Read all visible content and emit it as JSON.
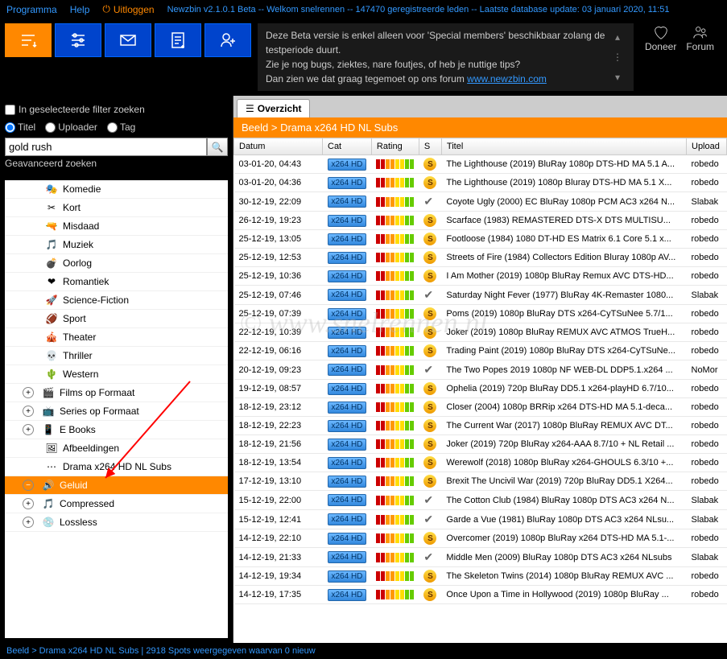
{
  "menu": {
    "programma": "Programma",
    "help": "Help",
    "uitloggen": "Uitloggen",
    "info": "Newzbin v2.1.0.1 Beta -- Welkom snelrennen -- 147470 geregistreerde leden -- Laatste database update: 03 januari 2020, 11:51"
  },
  "beta": {
    "l1": "Deze Beta versie is enkel alleen voor 'Special members' beschikbaar zolang de testperiode duurt.",
    "l2": "Zie je nog bugs, ziektes, nare foutjes, of heb je nuttige tips?",
    "l3": "Dan zien we dat graag tegemoet op ons forum ",
    "link": "www.newzbin.com"
  },
  "actions": {
    "doneer": "Doneer",
    "forum": "Forum"
  },
  "filter": {
    "chk": "In geselecteerde filter zoeken",
    "r1": "Titel",
    "r2": "Uploader",
    "r3": "Tag",
    "value": "gold rush",
    "adv": "Geavanceerd zoeken"
  },
  "tree": [
    {
      "lvl": 1,
      "icon": "🎭",
      "label": "Komedie"
    },
    {
      "lvl": 1,
      "icon": "✂",
      "label": "Kort"
    },
    {
      "lvl": 1,
      "icon": "🔫",
      "label": "Misdaad"
    },
    {
      "lvl": 1,
      "icon": "🎵",
      "label": "Muziek"
    },
    {
      "lvl": 1,
      "icon": "💣",
      "label": "Oorlog"
    },
    {
      "lvl": 1,
      "icon": "❤",
      "label": "Romantiek"
    },
    {
      "lvl": 1,
      "icon": "🚀",
      "label": "Science-Fiction"
    },
    {
      "lvl": 1,
      "icon": "🏈",
      "label": "Sport"
    },
    {
      "lvl": 1,
      "icon": "🎪",
      "label": "Theater"
    },
    {
      "lvl": 1,
      "icon": "💀",
      "label": "Thriller"
    },
    {
      "lvl": 1,
      "icon": "🌵",
      "label": "Western"
    },
    {
      "lvl": 0,
      "exp": "+",
      "icon": "🎬",
      "label": "Films op Formaat"
    },
    {
      "lvl": 0,
      "exp": "+",
      "icon": "📺",
      "label": "Series op Formaat"
    },
    {
      "lvl": 0,
      "exp": "+",
      "icon": "📱",
      "label": "E Books"
    },
    {
      "lvl": 1,
      "icon": "🖼",
      "label": "Afbeeldingen"
    },
    {
      "lvl": 1,
      "icon": "⋯",
      "label": "Drama x264 HD NL Subs"
    },
    {
      "lvl": 0,
      "exp": "−",
      "icon": "🔊",
      "label": "Geluid",
      "sel": true
    },
    {
      "lvl": 0,
      "exp": "+",
      "icon": "🎵",
      "label": "Compressed"
    },
    {
      "lvl": 0,
      "exp": "+",
      "icon": "💿",
      "label": "Lossless"
    }
  ],
  "tab": "Overzicht",
  "breadcrumb": "Beeld  >  Drama x264 HD NL Subs",
  "cols": {
    "datum": "Datum",
    "cat": "Cat",
    "rating": "Rating",
    "s": "S",
    "titel": "Titel",
    "upload": "Upload"
  },
  "badge": "x264 HD",
  "rows": [
    {
      "d": "03-01-20, 04:43",
      "s": "s",
      "t": "The Lighthouse (2019) BluRay 1080p DTS-HD MA 5.1 A...",
      "u": "robedo"
    },
    {
      "d": "03-01-20, 04:36",
      "s": "s",
      "t": "The Lighthouse (2019) 1080p Bluray DTS-HD MA 5.1 X...",
      "u": "robedo"
    },
    {
      "d": "30-12-19, 22:09",
      "s": "c",
      "t": "Coyote Ugly (2000) EC BluRay 1080p PCM AC3 x264 N...",
      "u": "Slabak"
    },
    {
      "d": "26-12-19, 19:23",
      "s": "s",
      "t": "Scarface (1983) REMASTERED DTS-X DTS MULTISU...",
      "u": "robedo"
    },
    {
      "d": "25-12-19, 13:05",
      "s": "s",
      "t": "Footloose (1984) 1080 DT-HD ES Matrix 6.1 Core 5.1 x...",
      "u": "robedo"
    },
    {
      "d": "25-12-19, 12:53",
      "s": "s",
      "t": "Streets of Fire (1984) Collectors Edition Bluray 1080p AV...",
      "u": "robedo"
    },
    {
      "d": "25-12-19, 10:36",
      "s": "s",
      "t": "I Am Mother (2019) 1080p BluRay Remux AVC DTS-HD...",
      "u": "robedo"
    },
    {
      "d": "25-12-19, 07:46",
      "s": "c",
      "t": "Saturday Night Fever (1977) BluRay 4K-Remaster 1080...",
      "u": "Slabak"
    },
    {
      "d": "25-12-19, 07:39",
      "s": "s",
      "t": "Poms (2019) 1080p BluRay DTS x264-CyTSuNee 5.7/1...",
      "u": "robedo"
    },
    {
      "d": "22-12-19, 10:39",
      "s": "s",
      "t": "Joker (2019) 1080p BluRay REMUX AVC ATMOS TrueH...",
      "u": "robedo"
    },
    {
      "d": "22-12-19, 06:16",
      "s": "s",
      "t": "Trading Paint (2019) 1080p BluRay DTS x264-CyTSuNe...",
      "u": "robedo"
    },
    {
      "d": "20-12-19, 09:23",
      "s": "c",
      "t": "The Two Popes 2019 1080p NF WEB-DL DDP5.1.x264 ...",
      "u": "NoMor"
    },
    {
      "d": "19-12-19, 08:57",
      "s": "s",
      "t": "Ophelia (2019) 720p BluRay DD5.1 x264-playHD 6.7/10...",
      "u": "robedo"
    },
    {
      "d": "18-12-19, 23:12",
      "s": "s",
      "t": "Closer (2004) 1080p BRRip x264 DTS-HD MA 5.1-deca...",
      "u": "robedo"
    },
    {
      "d": "18-12-19, 22:23",
      "s": "s",
      "t": "The Current War (2017) 1080p BluRay REMUX AVC DT...",
      "u": "robedo"
    },
    {
      "d": "18-12-19, 21:56",
      "s": "s",
      "t": "Joker (2019) 720p BluRay x264-AAA 8.7/10 + NL Retail ...",
      "u": "robedo"
    },
    {
      "d": "18-12-19, 13:54",
      "s": "s",
      "t": "Werewolf (2018) 1080p BluRay x264-GHOULS 6.3/10 +...",
      "u": "robedo"
    },
    {
      "d": "17-12-19, 13:10",
      "s": "s",
      "t": "Brexit The Uncivil War (2019) 720p BluRay DD5.1 X264...",
      "u": "robedo"
    },
    {
      "d": "15-12-19, 22:00",
      "s": "c",
      "t": "The Cotton Club (1984) BluRay 1080p DTS AC3 x264 N...",
      "u": "Slabak"
    },
    {
      "d": "15-12-19, 12:41",
      "s": "c",
      "t": "Garde a Vue (1981) BluRay 1080p DTS AC3 x264 NLsu...",
      "u": "Slabak"
    },
    {
      "d": "14-12-19, 22:10",
      "s": "s",
      "t": "Overcomer (2019) 1080p BluRay x264 DTS-HD MA 5.1-...",
      "u": "robedo"
    },
    {
      "d": "14-12-19, 21:33",
      "s": "c",
      "t": "Middle Men (2009) BluRay 1080p DTS AC3 x264 NLsubs",
      "u": "Slabak"
    },
    {
      "d": "14-12-19, 19:34",
      "s": "s",
      "t": "The Skeleton Twins (2014) 1080p BluRay REMUX AVC ...",
      "u": "robedo"
    },
    {
      "d": "14-12-19, 17:35",
      "s": "s",
      "t": "Once Upon a Time in Hollywood (2019) 1080p BluRay ...",
      "u": "robedo"
    }
  ],
  "status": "Beeld > Drama x264 HD NL Subs | 2918 Spots weergegeven waarvan 0 nieuw",
  "watermark": "© www.snelrennen.nl"
}
